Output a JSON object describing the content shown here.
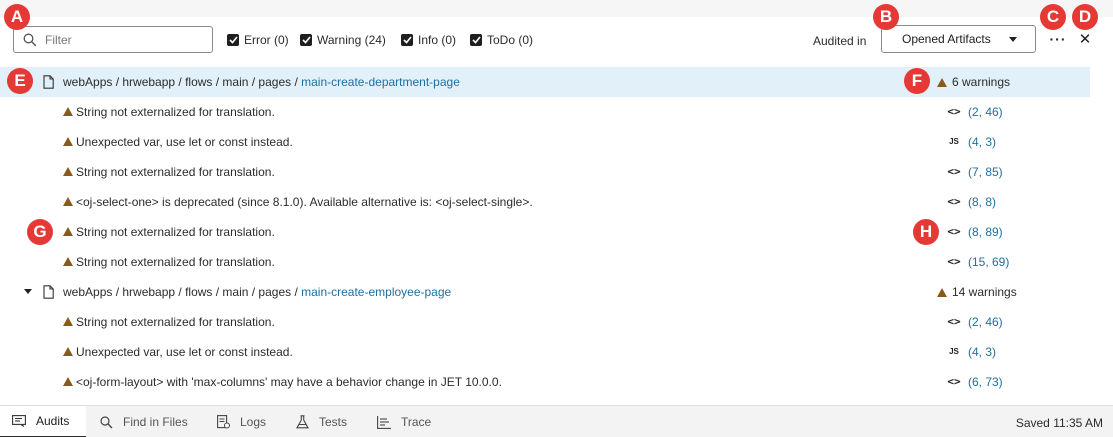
{
  "toolbar": {
    "filter_placeholder": "Filter",
    "checkboxes": [
      {
        "label": "Error (0)",
        "checked": true
      },
      {
        "label": "Warning (24)",
        "checked": true
      },
      {
        "label": "Info (0)",
        "checked": true
      },
      {
        "label": "ToDo (0)",
        "checked": true
      }
    ],
    "audited_in_label": "Audited in",
    "audited_in_value": "Opened Artifacts",
    "more_label": "···",
    "close_label": "✕"
  },
  "markers": [
    "A",
    "B",
    "C",
    "D",
    "E",
    "F",
    "G",
    "H"
  ],
  "groups": [
    {
      "path_prefix": "webApps / hrwebapp / flows / main / pages / ",
      "page": "main-create-department-page",
      "count_label": "6 warnings",
      "items": [
        {
          "message": "String not externalized for translation.",
          "type": "<>",
          "location": "(2, 46)"
        },
        {
          "message": "Unexpected var, use let or const instead.",
          "type": "JS",
          "location": "(4, 3)"
        },
        {
          "message": "String not externalized for translation.",
          "type": "<>",
          "location": "(7, 85)"
        },
        {
          "message": "<oj-select-one> is deprecated (since 8.1.0). Available alternative is: <oj-select-single>.",
          "type": "<>",
          "location": "(8, 8)"
        },
        {
          "message": "String not externalized for translation.",
          "type": "<>",
          "location": "(8, 89)"
        },
        {
          "message": "String not externalized for translation.",
          "type": "<>",
          "location": "(15, 69)"
        }
      ]
    },
    {
      "path_prefix": "webApps / hrwebapp / flows / main / pages / ",
      "page": "main-create-employee-page",
      "count_label": "14 warnings",
      "items": [
        {
          "message": "String not externalized for translation.",
          "type": "<>",
          "location": "(2, 46)"
        },
        {
          "message": "Unexpected var, use let or const instead.",
          "type": "JS",
          "location": "(4, 3)"
        },
        {
          "message": "<oj-form-layout> with 'max-columns' may have a behavior change in JET 10.0.0.",
          "type": "<>",
          "location": "(6, 73)"
        }
      ]
    }
  ],
  "bottom_tabs": [
    "Audits",
    "Find in Files",
    "Logs",
    "Tests",
    "Trace"
  ],
  "status": "Saved 11:35 AM",
  "colors": {
    "accent": "#1f6f9e",
    "warning": "#8a5a1c",
    "marker": "#e53935",
    "highlight": "#e2f0f9"
  }
}
